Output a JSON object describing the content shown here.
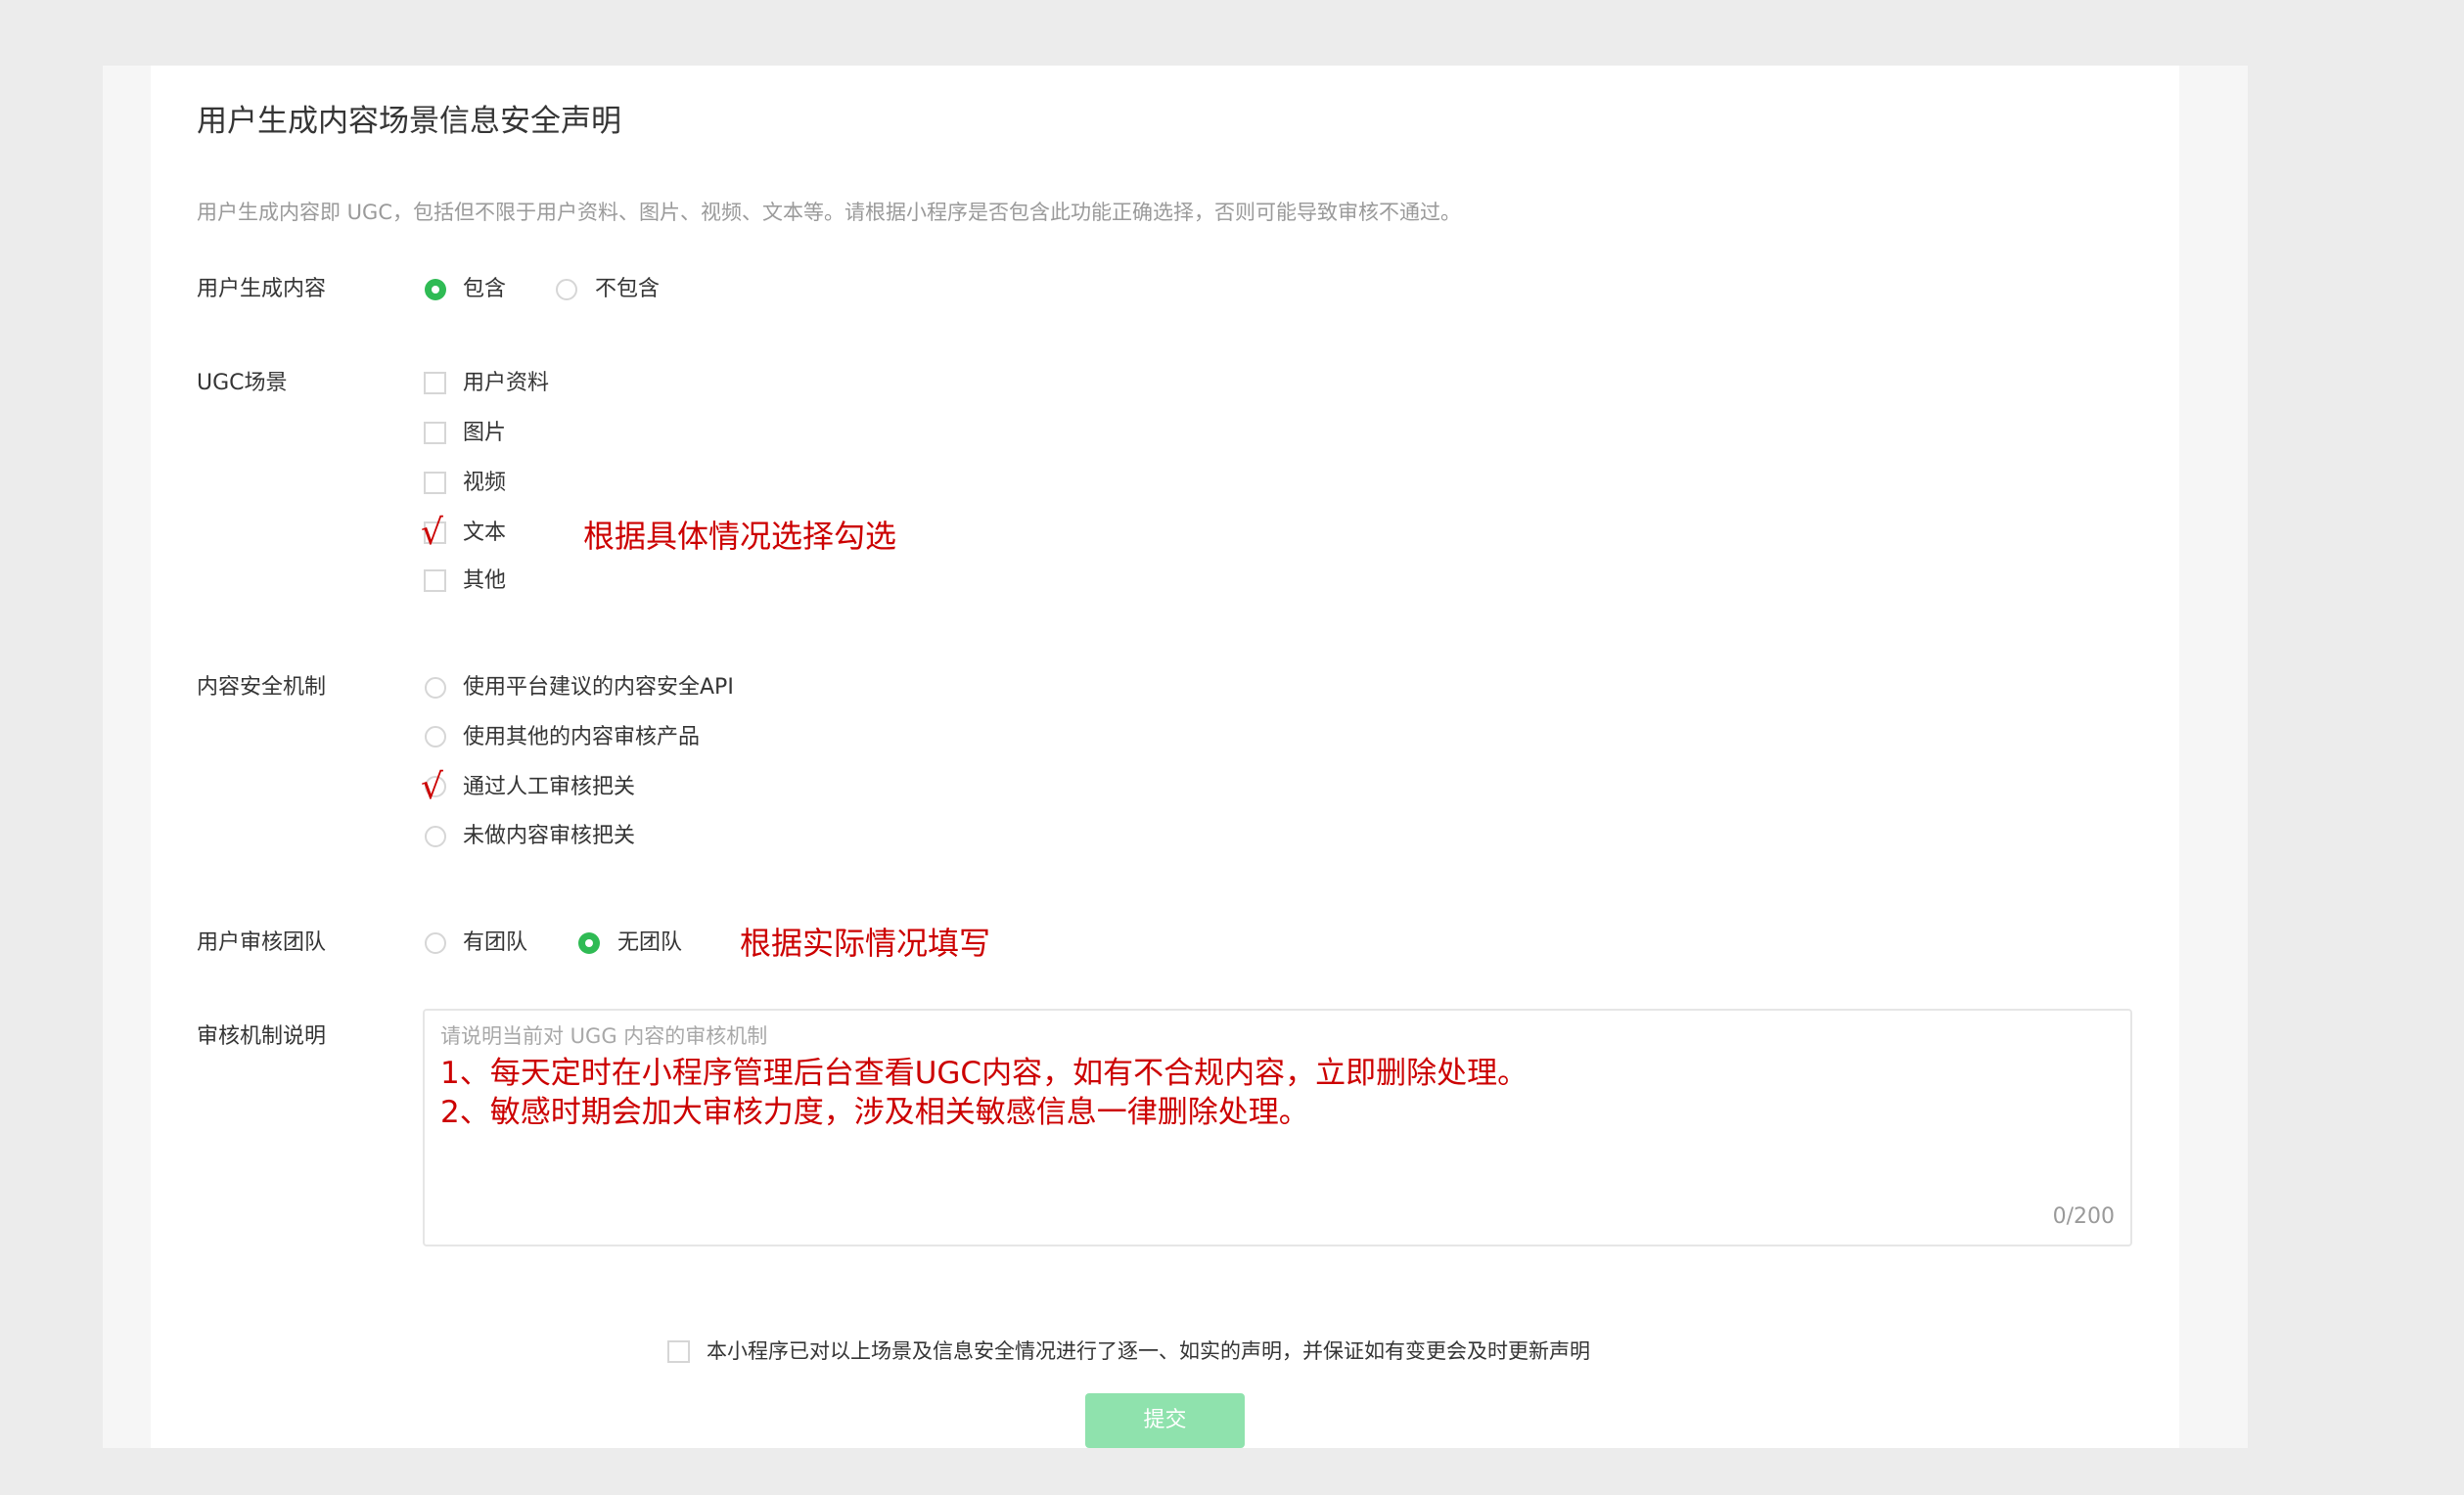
{
  "page": {
    "title": "用户生成内容场景信息安全声明",
    "description": "用户生成内容即 UGC，包括但不限于用户资料、图片、视频、文本等。请根据小程序是否包含此功能正确选择，否则可能导致审核不通过。"
  },
  "ugc_content": {
    "label": "用户生成内容",
    "options": [
      "包含",
      "不包含"
    ],
    "selected": "包含"
  },
  "ugc_scenes": {
    "label": "UGC场景",
    "options": [
      "用户资料",
      "图片",
      "视频",
      "文本",
      "其他"
    ],
    "marked": [
      "文本"
    ],
    "note": "根据具体情况选择勾选"
  },
  "safety_mechanism": {
    "label": "内容安全机制",
    "options": [
      "使用平台建议的内容安全API",
      "使用其他的内容审核产品",
      "通过人工审核把关",
      "未做内容审核把关"
    ],
    "marked": "通过人工审核把关"
  },
  "review_team": {
    "label": "用户审核团队",
    "options": [
      "有团队",
      "无团队"
    ],
    "selected": "无团队",
    "note": "根据实际情况填写"
  },
  "mechanism_desc": {
    "label": "审核机制说明",
    "placeholder": "请说明当前对 UGG 内容的审核机制",
    "lines": [
      "1、每天定时在小程序管理后台查看UGC内容，如有不合规内容，立即删除处理。",
      "2、敏感时期会加大审核力度，涉及相关敏感信息一律删除处理。"
    ],
    "counter": "0/200"
  },
  "declaration": {
    "text": "本小程序已对以上场景及信息安全情况进行了逐一、如实的声明，并保证如有变更会及时更新声明"
  },
  "submit_label": "提交",
  "colors": {
    "accent_green": "#2fbb54",
    "submit_disabled": "#8fe2ad",
    "annotation_red": "#cc0000"
  }
}
